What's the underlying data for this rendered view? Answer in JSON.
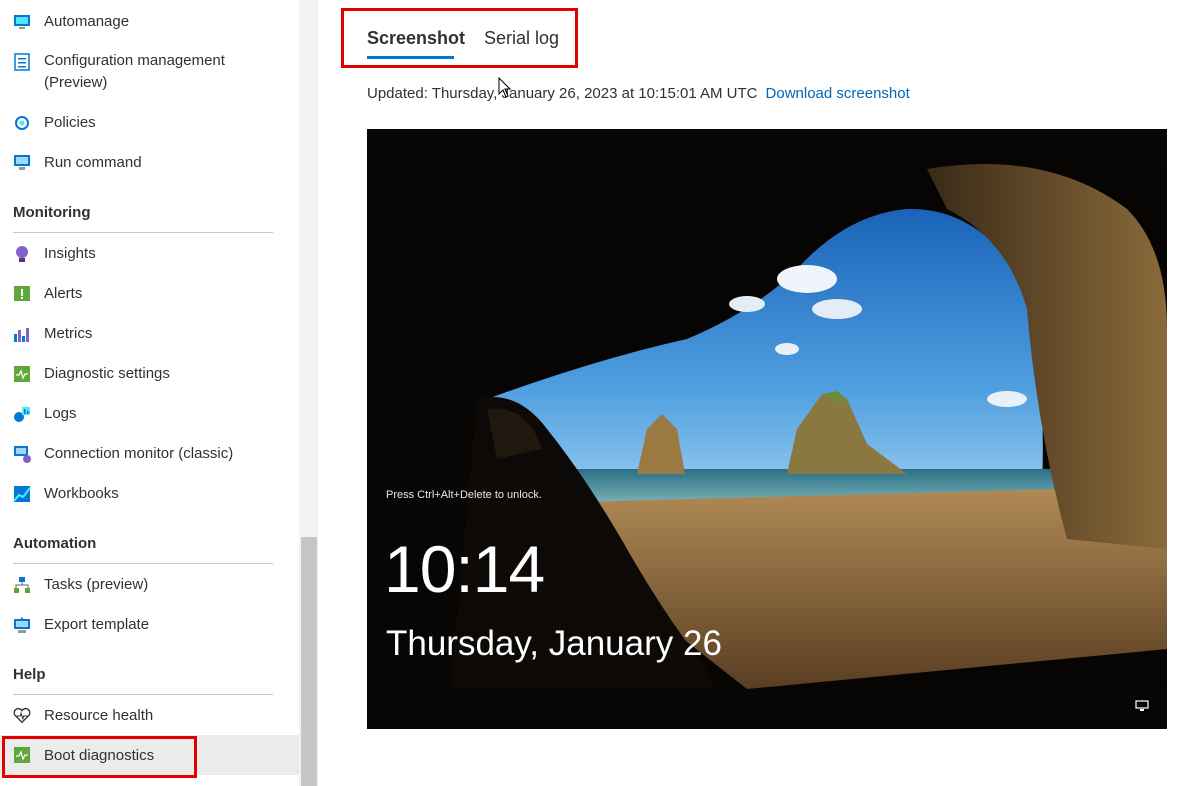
{
  "sidebar": {
    "items_top": [
      {
        "label": "Automanage",
        "icon": "automanage-icon"
      },
      {
        "label": "Configuration management",
        "label2": "(Preview)",
        "icon": "configuration-icon"
      },
      {
        "label": "Policies",
        "icon": "policies-icon"
      },
      {
        "label": "Run command",
        "icon": "run-command-icon"
      }
    ],
    "monitoring": {
      "title": "Monitoring",
      "items": [
        {
          "label": "Insights",
          "icon": "insights-icon"
        },
        {
          "label": "Alerts",
          "icon": "alerts-icon"
        },
        {
          "label": "Metrics",
          "icon": "metrics-icon"
        },
        {
          "label": "Diagnostic settings",
          "icon": "diagnostic-settings-icon"
        },
        {
          "label": "Logs",
          "icon": "logs-icon"
        },
        {
          "label": "Connection monitor (classic)",
          "icon": "connection-monitor-icon"
        },
        {
          "label": "Workbooks",
          "icon": "workbooks-icon"
        }
      ]
    },
    "automation": {
      "title": "Automation",
      "items": [
        {
          "label": "Tasks (preview)",
          "icon": "tasks-icon"
        },
        {
          "label": "Export template",
          "icon": "export-template-icon"
        }
      ]
    },
    "help": {
      "title": "Help",
      "items": [
        {
          "label": "Resource health",
          "icon": "heart-icon"
        },
        {
          "label": "Boot diagnostics",
          "icon": "boot-diagnostics-icon"
        }
      ]
    }
  },
  "main": {
    "tabs": [
      {
        "label": "Screenshot",
        "selected": true
      },
      {
        "label": "Serial log",
        "selected": false
      }
    ],
    "updated_text": "Updated: Thursday, January 26, 2023 at 10:15:01 AM UTC",
    "download_label": "Download screenshot",
    "lock_screen": {
      "hint": "Press Ctrl+Alt+Delete to unlock.",
      "time": "10:14",
      "date": "Thursday, January 26"
    }
  },
  "colors": {
    "accent": "#0078d4",
    "link": "#0067b8",
    "highlight_box": "#e00000",
    "active_row": "#edebe9"
  }
}
